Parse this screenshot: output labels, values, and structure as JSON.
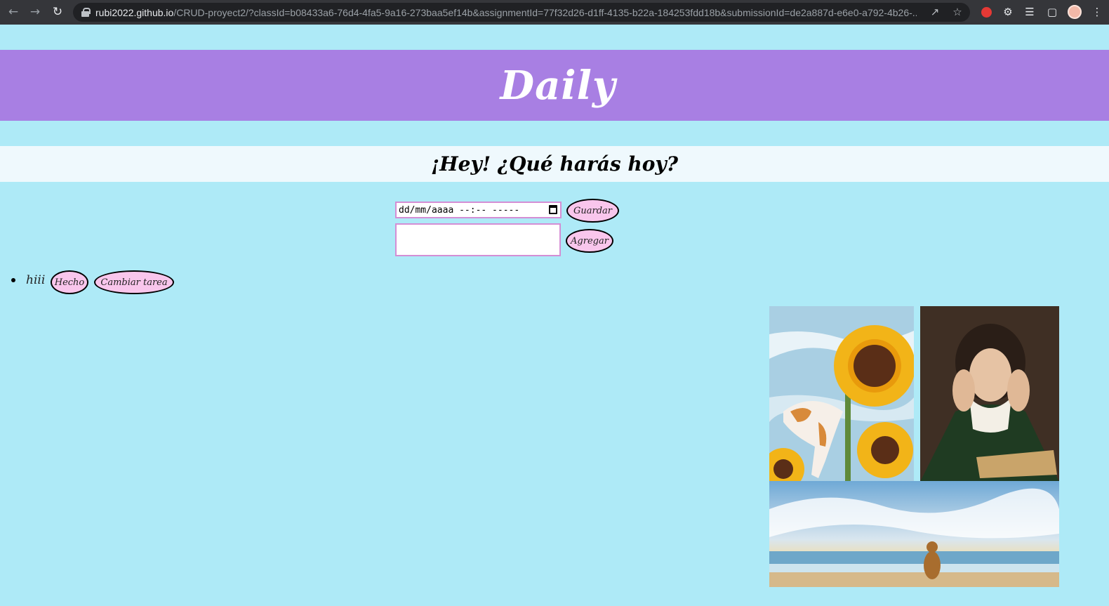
{
  "browser": {
    "url_host": "rubi2022.github.io",
    "url_path": "/CRUD-proyect2/?classId=b08433a6-76d4-4fa5-9a16-273baa5ef14b&assignmentId=77f32d26-d1ff-4135-b22a-184253fdd18b&submissionId=de2a887d-e6e0-a792-4b26-..."
  },
  "header": {
    "logo": "Daily"
  },
  "greeting": "¡Hey! ¿Qué harás hoy?",
  "form": {
    "datetime_placeholder": "dd/mm/aaaa --:-- -----",
    "save_label": "Guardar",
    "task_value": "",
    "add_label": "Agregar"
  },
  "tasks": [
    {
      "text": "hiii",
      "done_label": "Hecho",
      "change_label": "Cambiar tarea"
    }
  ],
  "gallery": [
    {
      "name": "sunflower-cat-painting"
    },
    {
      "name": "woman-portrait-painting"
    },
    {
      "name": "dog-beach-painting"
    }
  ],
  "colors": {
    "background": "#aeeaf7",
    "header": "#a87fe3",
    "greeting_band": "#eff9fd",
    "button_fill": "#f9c6ec",
    "input_border": "#d48ed4"
  }
}
